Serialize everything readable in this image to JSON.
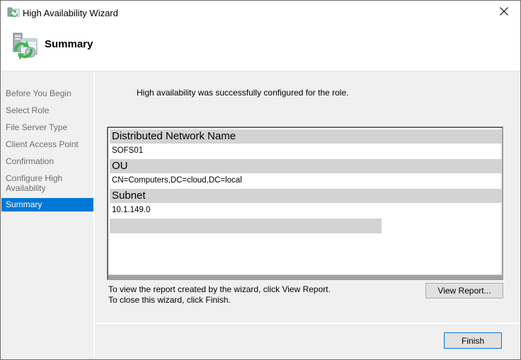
{
  "window": {
    "title": "High Availability Wizard",
    "icon": "cluster-wizard-icon",
    "close_icon": "close-icon"
  },
  "header": {
    "title": "Summary",
    "icon": "cluster-wizard-large-icon"
  },
  "sidebar": {
    "items": [
      {
        "label": "Before You Begin",
        "active": false
      },
      {
        "label": "Select Role",
        "active": false
      },
      {
        "label": "File Server Type",
        "active": false
      },
      {
        "label": "Client Access Point",
        "active": false
      },
      {
        "label": "Confirmation",
        "active": false
      },
      {
        "label": "Configure High Availability",
        "line1": "Configure High",
        "line2": "Availability",
        "active": false
      },
      {
        "label": "Summary",
        "active": true
      }
    ]
  },
  "main": {
    "status": "High availability was successfully configured for the role.",
    "report": {
      "sections": [
        {
          "header": "Distributed Network Name",
          "value": "SOFS01"
        },
        {
          "header": "OU",
          "value": "CN=Computers,DC=cloud,DC=local"
        },
        {
          "header": "Subnet",
          "value": "10.1.149.0"
        }
      ]
    },
    "hint_view": "To view the report created by the wizard, click View Report.",
    "hint_close": "To close this wizard, click Finish.",
    "view_report_label": "View Report..."
  },
  "footer": {
    "finish_label": "Finish"
  },
  "colors": {
    "accent": "#0078d7",
    "panel": "#f0f0f0",
    "section_header": "#d3d3d3"
  }
}
